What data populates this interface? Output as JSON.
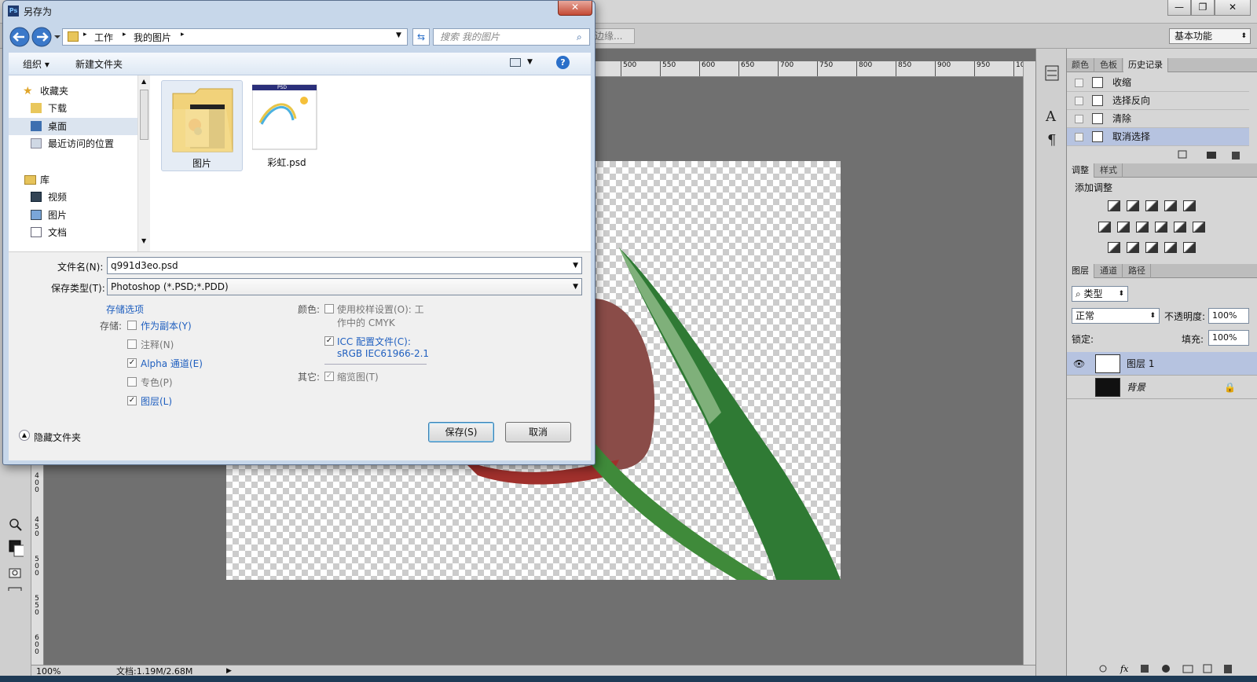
{
  "ps": {
    "window_controls": {
      "minimize": "—",
      "restore": "❐",
      "close": "✕"
    },
    "edge_button": "边缘...",
    "workspace": "基本功能",
    "ruler_top": [
      "500",
      "550",
      "600",
      "650",
      "700",
      "750",
      "800",
      "850",
      "900",
      "950",
      "10"
    ],
    "ruler_left": [
      [
        "4",
        "0",
        "0"
      ],
      [
        "4",
        "5",
        "0"
      ],
      [
        "5",
        "0",
        "0"
      ],
      [
        "5",
        "5",
        "0"
      ],
      [
        "6",
        "0",
        "0"
      ]
    ],
    "status": {
      "zoom": "100%",
      "doc": "文档:1.19M/2.68M"
    }
  },
  "panels": {
    "history_tabs": [
      "颜色",
      "色板",
      "历史记录"
    ],
    "history_items": [
      "收缩",
      "选择反向",
      "清除",
      "取消选择"
    ],
    "adjust_tabs": [
      "调整",
      "样式"
    ],
    "adjust_title": "添加调整",
    "layers_tabs": [
      "图层",
      "通道",
      "路径"
    ],
    "filter_type": "类型",
    "blend_mode": "正常",
    "opacity_label": "不透明度:",
    "opacity_value": "100%",
    "lock_label": "锁定:",
    "fill_label": "填充:",
    "fill_value": "100%",
    "layers": [
      {
        "name": "图层 1"
      },
      {
        "name": "背景"
      }
    ]
  },
  "dialog": {
    "title": "另存为",
    "close": "✕",
    "address": [
      "工作",
      "我的图片"
    ],
    "search_placeholder": "搜索 我的图片",
    "toolbar": {
      "organize": "组织 ▾",
      "new_folder": "新建文件夹",
      "help": "?"
    },
    "nav": {
      "favorites": "收藏夹",
      "items1": [
        "下载",
        "桌面",
        "最近访问的位置"
      ],
      "library": "库",
      "items2": [
        "视频",
        "图片",
        "文档"
      ]
    },
    "files": [
      {
        "name": "图片"
      },
      {
        "name": "彩虹.psd",
        "badge": "PSD"
      }
    ],
    "filename_label": "文件名(N):",
    "filename_value": "q991d3eo.psd",
    "filetype_label": "保存类型(T):",
    "filetype_value": "Photoshop (*.PSD;*.PDD)",
    "save_options": "存储选项",
    "save_label": "存储:",
    "opt_copy": "作为副本(Y)",
    "opt_notes": "注释(N)",
    "opt_alpha": "Alpha 通道(E)",
    "opt_spot": "专色(P)",
    "opt_layers": "图层(L)",
    "color_label": "颜色:",
    "proof_line1": "使用校样设置(O): 工",
    "proof_line2": "作中的 CMYK",
    "icc_line1": "ICC 配置文件(C):",
    "icc_line2": "sRGB IEC61966-2.1",
    "other_label": "其它:",
    "thumb": "缩览图(T)",
    "hide_folders": "隐藏文件夹",
    "save_btn": "保存(S)",
    "cancel_btn": "取消",
    "check": "✓"
  }
}
